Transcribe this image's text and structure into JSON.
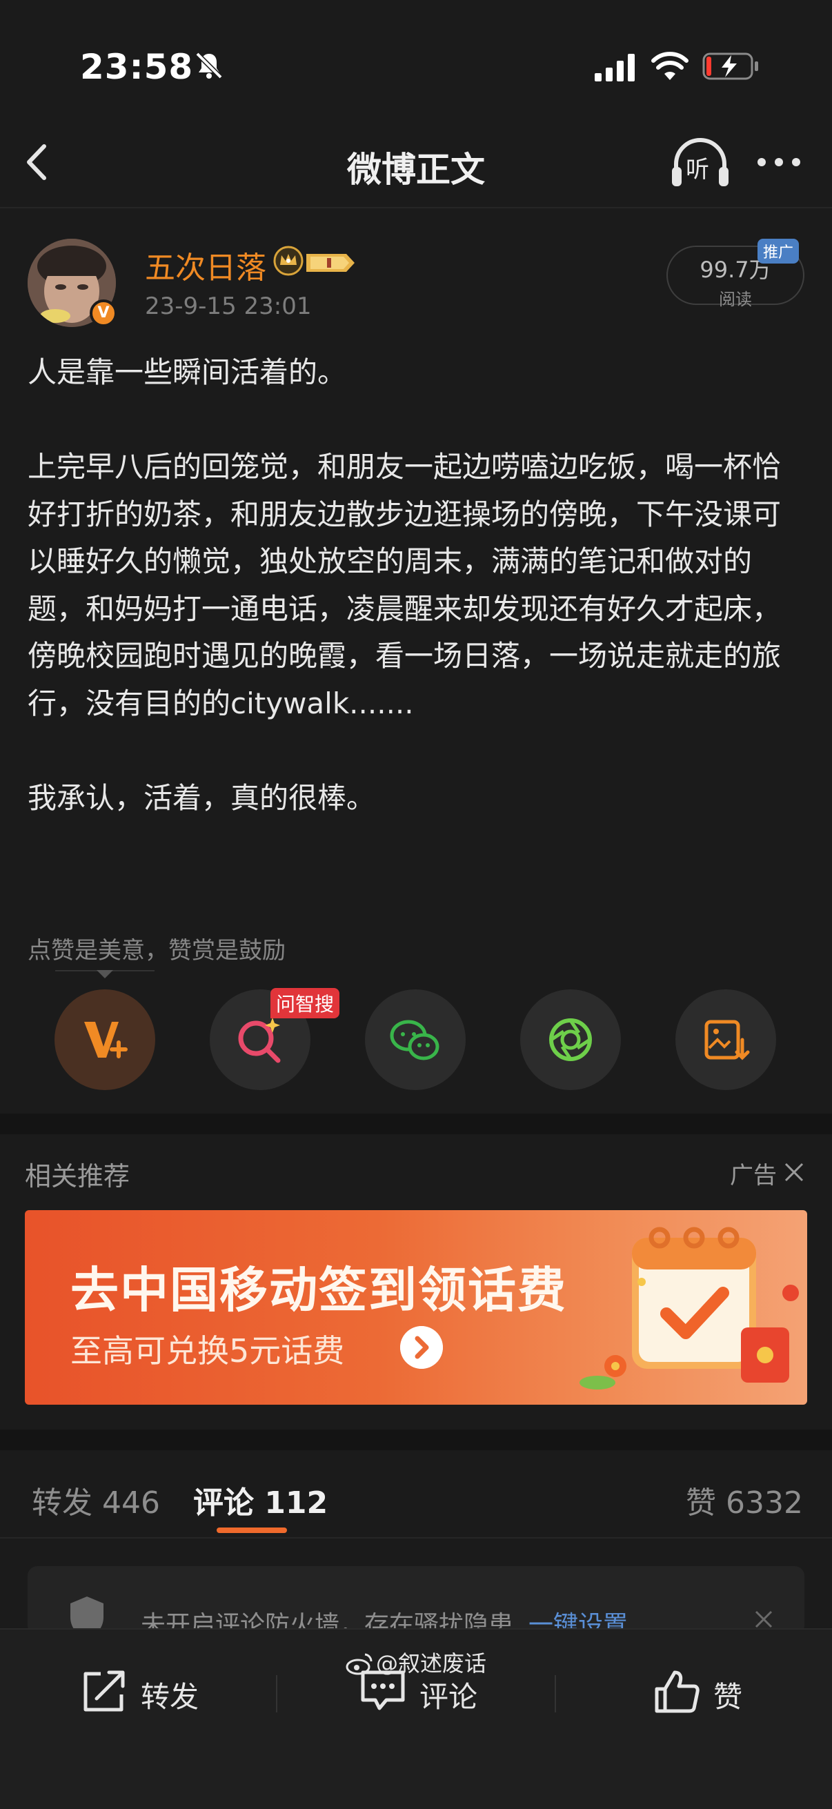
{
  "status_bar": {
    "time": "23:58"
  },
  "nav": {
    "title": "微博正文",
    "listen_label": "听"
  },
  "post": {
    "author": "五次日落",
    "timestamp": "23-9-15 23:01",
    "reads_count": "99.7万",
    "reads_label": "阅读",
    "promo_tag": "推广",
    "paragraphs": [
      "人是靠一些瞬间活着的。",
      "上完早八后的回笼觉，和朋友一起边唠嗑边吃饭，喝一杯恰好打折的奶茶，和朋友边散步边逛操场的傍晚，下午没课可以睡好久的懒觉，独处放空的周末，满满的笔记和做对的题，和妈妈打一通电话，凌晨醒来却发现还有好久才起床，傍晚校园跑时遇见的晚霞，看一场日落，一场说走就走的旅行，没有目的的citywalk.......",
      "我承认，活着，真的很棒。"
    ],
    "reward_text": "点赞是美意，赞赏是鼓励",
    "ai_search_tag": "问智搜"
  },
  "related": {
    "title": "相关推荐",
    "ad_label": "广告",
    "ad_headline": "去中国移动签到领话费",
    "ad_subline": "至高可兑换5元话费"
  },
  "tabs": {
    "repost": "转发 446",
    "comment": "评论 112",
    "like": "赞 6332"
  },
  "firewall": {
    "text": "未开启评论防火墙，存在骚扰隐患",
    "link": "一键设置"
  },
  "bottom_bar": {
    "forward": "转发",
    "comment": "评论",
    "like": "赞"
  },
  "watermark": "@叙述废话",
  "colors": {
    "accent": "#f06a2c",
    "author": "#f08a24",
    "link": "#5a8fd6"
  }
}
